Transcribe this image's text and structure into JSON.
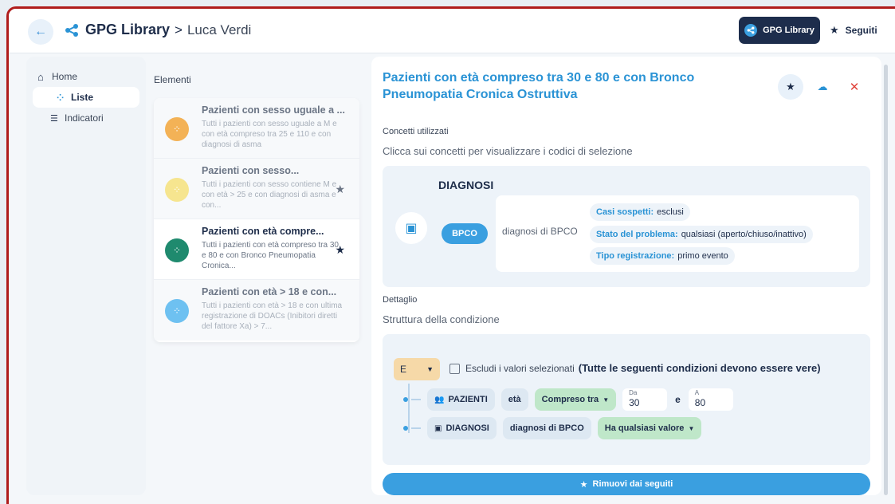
{
  "header": {
    "back_icon": "arrow-left-icon",
    "brand_title": "GPG Library",
    "separator": ">",
    "user": "Luca Verdi",
    "chip_primary": "GPG Library",
    "chip_secondary": "Seguiti"
  },
  "sidebar": {
    "items": [
      {
        "label": "Home",
        "icon": "home-icon"
      },
      {
        "label": "Liste",
        "icon": "share-icon"
      },
      {
        "label": "Indicatori",
        "icon": "list-icon"
      }
    ]
  },
  "list": {
    "label": "Elementi",
    "items": [
      {
        "title": "Pazienti con sesso uguale a ...",
        "desc": "Tutti i pazienti con sesso uguale a M e con età compreso tra 25 e 110 e con diagnosi di asma",
        "color": "#f3b256",
        "fav": false
      },
      {
        "title": "Pazienti con sesso...",
        "desc": "Tutti i pazienti con sesso contiene M e con età > 25 e con diagnosi di asma e con...",
        "color": "#f6e58f",
        "fav": true
      },
      {
        "title": "Pazienti con età compre...",
        "desc": "Tutti i pazienti con età compreso tra 30 e 80 e con Bronco Pneumopatia Cronica...",
        "color": "#1f8a6e",
        "fav": true
      },
      {
        "title": "Pazienti con età > 18 e con...",
        "desc": "Tutti i pazienti con età > 18 e con ultima registrazione di DOACs (Inibitori diretti del fattore Xa) > 7...",
        "color": "#6ec1f1",
        "fav": false
      }
    ]
  },
  "detail": {
    "title": "Pazienti con età compreso tra 30 e 80 e con Bronco Pneumopatia Cronica Ostruttiva",
    "concepts_label": "Concetti utilizzati",
    "concepts_hint": "Clicca sui concetti per visualizzare i codici di selezione",
    "concept": {
      "title": "DIAGNOSI",
      "pill": "BPCO",
      "desc": "diagnosi di BPCO",
      "tags": [
        {
          "key": "Casi sospetti:",
          "value": "esclusi"
        },
        {
          "key": "Stato del problema:",
          "value": "qualsiasi (aperto/chiuso/inattivo)"
        },
        {
          "key": "Tipo registrazione:",
          "value": "primo evento"
        }
      ]
    },
    "detail_label": "Dettaglio",
    "structure_hint": "Struttura della condizione",
    "condition": {
      "operator": "E",
      "exclude_label": "Escludi i valori selezionati",
      "rule_text": "(Tutte le seguenti condizioni devono essere vere)",
      "row1": {
        "entity": "PAZIENTI",
        "field": "età",
        "op": "Compreso tra",
        "from_label": "Da",
        "from_value": "30",
        "and": "e",
        "to_label": "A",
        "to_value": "80"
      },
      "row2": {
        "entity": "DIAGNOSI",
        "field": "diagnosi di BPCO",
        "op": "Ha qualsiasi valore"
      }
    },
    "remove_label": "Rimuovi dai seguiti"
  }
}
